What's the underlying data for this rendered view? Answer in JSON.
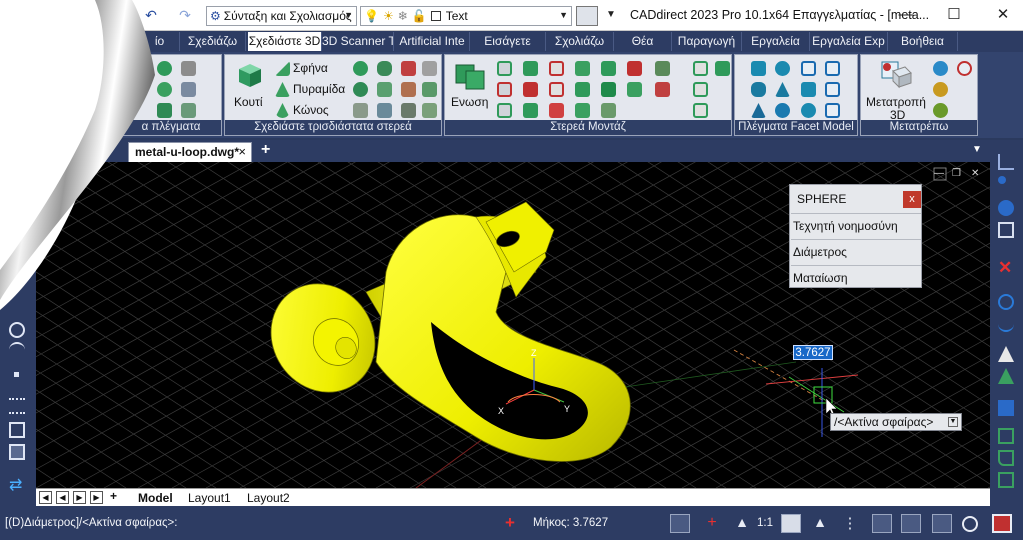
{
  "titlebar": {
    "workspace_combo": "Σύνταξη και Σχολιασμός",
    "layer_name": "Text",
    "app_title": "CADdirect 2023 Pro 10.1x64 Επαγγελματίας - [meta..."
  },
  "ribbon_tabs": [
    "Σχεδιάζω",
    "Σχεδιάστε 3D",
    "3D Scanner T",
    "Artificial Inte",
    "Εισάγετε",
    "Σχολιάζω",
    "Θέα",
    "Παραγωγή",
    "Εργαλεία",
    "Εργαλεία Exp",
    "Βοήθεια"
  ],
  "ribbon_tab_first_partial": "ίο",
  "ribbon": {
    "panel_meshes_label": "α πλέγματα",
    "panel_solids_label": "Σχεδιάστε τρισδιάστατα στερεά",
    "box_label": "Κουτί",
    "wedge_label": "Σφήνα",
    "pyramid_label": "Πυραμίδα",
    "cone_label": "Κώνος",
    "panel_solid_mod_label": "Στερεά Μοντάζ",
    "union_label": "Ενωση",
    "panel_facet_label": "Πλέγματα Facet Model",
    "panel_convert_label": "Μετατρέπω",
    "convert_label_1": "Μετατροπή",
    "convert_label_2": "3D"
  },
  "document": {
    "tab_label": "metal-u-loop.dwg*",
    "close_glyph": "×",
    "add_glyph": "+"
  },
  "viewport": {
    "popup": {
      "title": "SPHERE",
      "close_label": "x",
      "items": [
        "Τεχνητή νοημοσύνη",
        "Διάμετρος",
        "Ματαίωση"
      ]
    },
    "dim_value": "3.7627",
    "prompt_tooltip": "/<Ακτίνα σφαίρας>",
    "ucs_labels": {
      "x": "X",
      "y": "Y",
      "z": "Z"
    }
  },
  "layout_tabs": [
    "Model",
    "Layout1",
    "Layout2"
  ],
  "statusbar": {
    "command_line": "[(D)Διάμετρος]/<Ακτίνα σφαίρας>:",
    "length_text": "Μήκος: 3.7627",
    "scale_text": "1:1"
  },
  "colors": {
    "model_yellow": "#f2f200",
    "chrome_navy": "#2d3c63",
    "popup_close_red": "#c0392b",
    "dim_input_blue": "#1868c8"
  }
}
